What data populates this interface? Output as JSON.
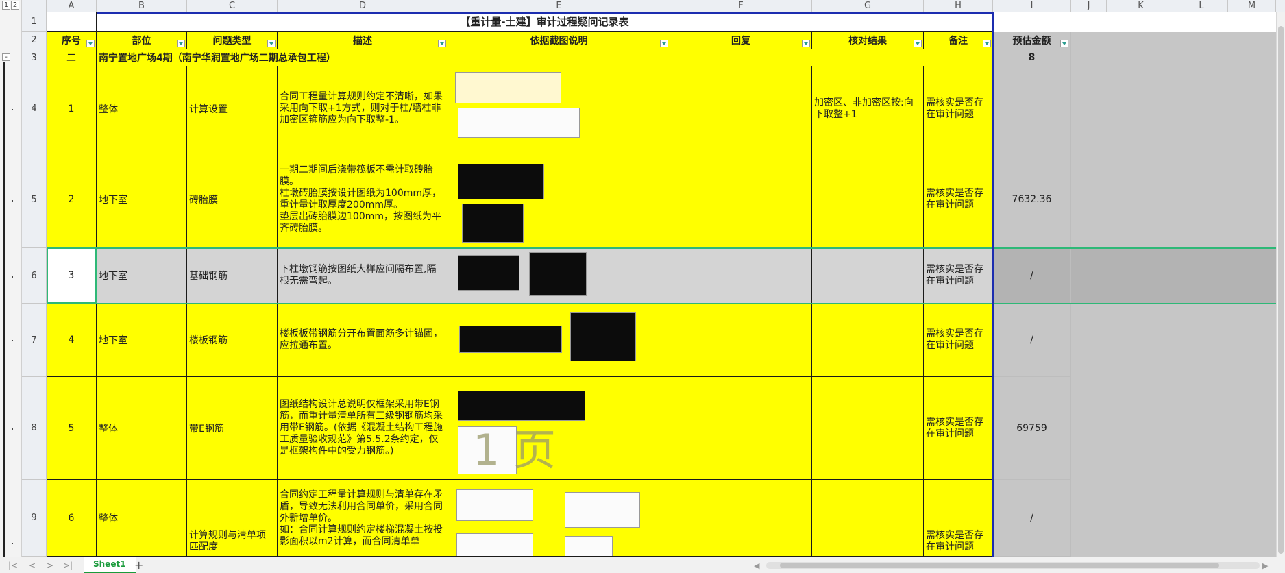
{
  "outline": {
    "level1": "1",
    "level2": "2",
    "collapse": "-"
  },
  "columns": [
    "A",
    "B",
    "C",
    "D",
    "E",
    "F",
    "G",
    "H",
    "I",
    "J",
    "K",
    "L",
    "M"
  ],
  "rows": [
    "1",
    "2",
    "3",
    "4",
    "5",
    "6",
    "7",
    "8",
    "9"
  ],
  "sheet": {
    "title": "【重计量-土建】审计过程疑问记录表",
    "headers": {
      "seq": "序号",
      "part": "部位",
      "issue_type": "问题类型",
      "desc": "描述",
      "screenshot": "依据截图说明",
      "reply": "回复",
      "check": "核对结果",
      "remark": "备注",
      "amount": "预估金额"
    },
    "section": {
      "num": "二",
      "name": "南宁置地广场4期（南宁华润置地广场二期总承包工程）",
      "amount": "8"
    },
    "records": [
      {
        "seq": "1",
        "part": "整体",
        "type": "计算设置",
        "desc": "合同工程量计算规则约定不清晰，如果采用向下取+1方式，则对于柱/墙柱非加密区箍筋应为向下取整-1。",
        "reply": "",
        "check": "加密区、非加密区按:向下取整+1",
        "remark": "需核实是否存在审计问题",
        "amount": ""
      },
      {
        "seq": "2",
        "part": "地下室",
        "type": "砖胎膜",
        "desc": "一期二期间后浇带筏板不需计取砖胎膜。\n柱墩砖胎膜按设计图纸为100mm厚，重计量计取厚度200mm厚。\n垫层出砖胎膜边100mm，按图纸为平齐砖胎膜。",
        "reply": "",
        "check": "",
        "remark": "需核实是否存在审计问题",
        "amount": "7632.36"
      },
      {
        "seq": "3",
        "part": "地下室",
        "type": "基础钢筋",
        "desc": "下柱墩钢筋按图纸大样应间隔布置,隔根无需弯起。",
        "reply": "",
        "check": "",
        "remark": "需核实是否存在审计问题",
        "amount": "/"
      },
      {
        "seq": "4",
        "part": "地下室",
        "type": "楼板钢筋",
        "desc": "楼板板带钢筋分开布置面筋多计锚固，应拉通布置。",
        "reply": "",
        "check": "",
        "remark": "需核实是否存在审计问题",
        "amount": "/"
      },
      {
        "seq": "5",
        "part": "整体",
        "type": "带E钢筋",
        "desc": "图纸结构设计总说明仅框架采用带E钢筋，而重计量清单所有三级钢钢筋均采用带E钢筋。(依据《混凝土结构工程施工质量验收规范》第5.5.2条约定，仅是框架构件中的受力钢筋。)",
        "reply": "",
        "check": "",
        "remark": "需核实是否存在审计问题",
        "amount": "69759"
      },
      {
        "seq": "6",
        "part": "整体",
        "type": "计算规则与清单项匹配度",
        "desc": "合同约定工程量计算规则与清单存在矛盾，导致无法利用合同单价，采用合同外新增单价。\n如：合同计算规则约定楼梯混凝土按投影面积以m2计算，而合同清单单",
        "reply": "",
        "check": "",
        "remark": "需核实是否存在审计问题",
        "amount": "/"
      }
    ],
    "watermark": "1 页"
  },
  "tabs": {
    "sheet1": "Sheet1",
    "add": "+",
    "nav_first": "|<",
    "nav_prev": "<",
    "nav_next": ">",
    "nav_last": ">|"
  }
}
